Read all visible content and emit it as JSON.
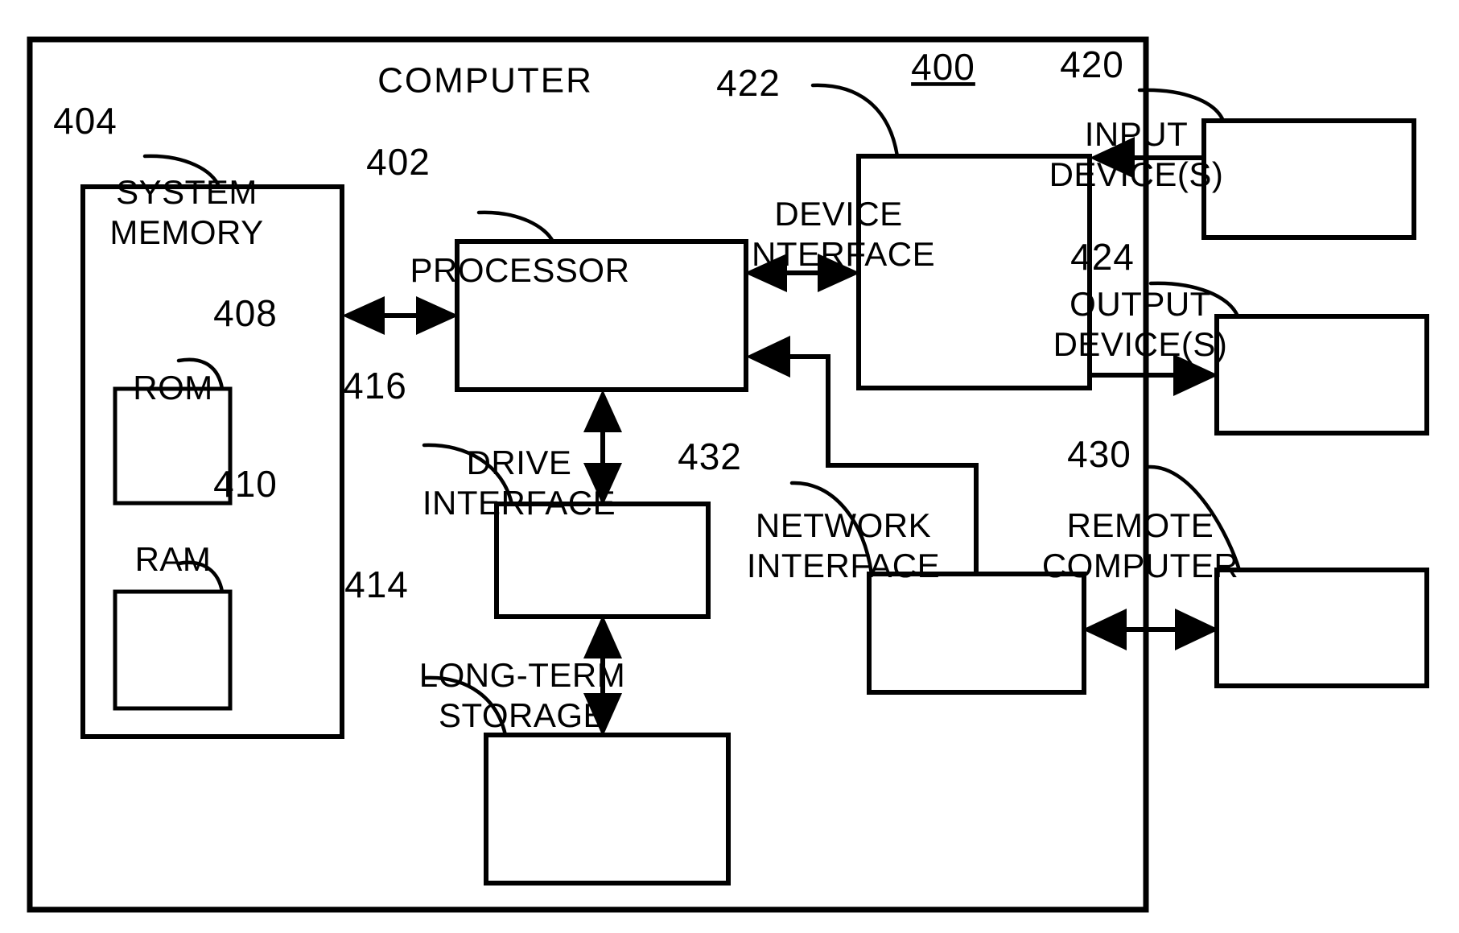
{
  "figure": {
    "title": "COMPUTER",
    "figure_ref": "400"
  },
  "blocks": {
    "system_memory": {
      "line1": "SYSTEM",
      "line2": "MEMORY",
      "ref": "404"
    },
    "rom": {
      "label": "ROM",
      "ref": "408"
    },
    "ram": {
      "label": "RAM",
      "ref": "410"
    },
    "processor": {
      "label": "PROCESSOR",
      "ref": "402"
    },
    "device_interface": {
      "line1": "DEVICE",
      "line2": "INTERFACE",
      "ref": "422"
    },
    "drive_interface": {
      "line1": "DRIVE",
      "line2": "INTERFACE",
      "ref": "416"
    },
    "long_term_storage": {
      "line1": "LONG-TERM",
      "line2": "STORAGE",
      "ref": "414"
    },
    "network_interface": {
      "line1": "NETWORK",
      "line2": "INTERFACE",
      "ref": "432"
    },
    "input_devices": {
      "line1": "INPUT",
      "line2": "DEVICE(S)",
      "ref": "420"
    },
    "output_devices": {
      "line1": "OUTPUT",
      "line2": "DEVICE(S)",
      "ref": "424"
    },
    "remote_computer": {
      "line1": "REMOTE",
      "line2": "COMPUTER",
      "ref": "430"
    }
  },
  "connections": [
    {
      "name": "system-memory-to-processor",
      "type": "bidirectional"
    },
    {
      "name": "processor-to-device-interface",
      "type": "bidirectional"
    },
    {
      "name": "processor-to-drive-interface",
      "type": "bidirectional"
    },
    {
      "name": "drive-interface-to-long-term-storage",
      "type": "bidirectional"
    },
    {
      "name": "input-devices-to-device-interface",
      "type": "unidirectional"
    },
    {
      "name": "device-interface-to-output-devices",
      "type": "unidirectional"
    },
    {
      "name": "network-interface-to-processor",
      "type": "unidirectional"
    },
    {
      "name": "network-interface-to-remote-computer",
      "type": "bidirectional"
    }
  ]
}
